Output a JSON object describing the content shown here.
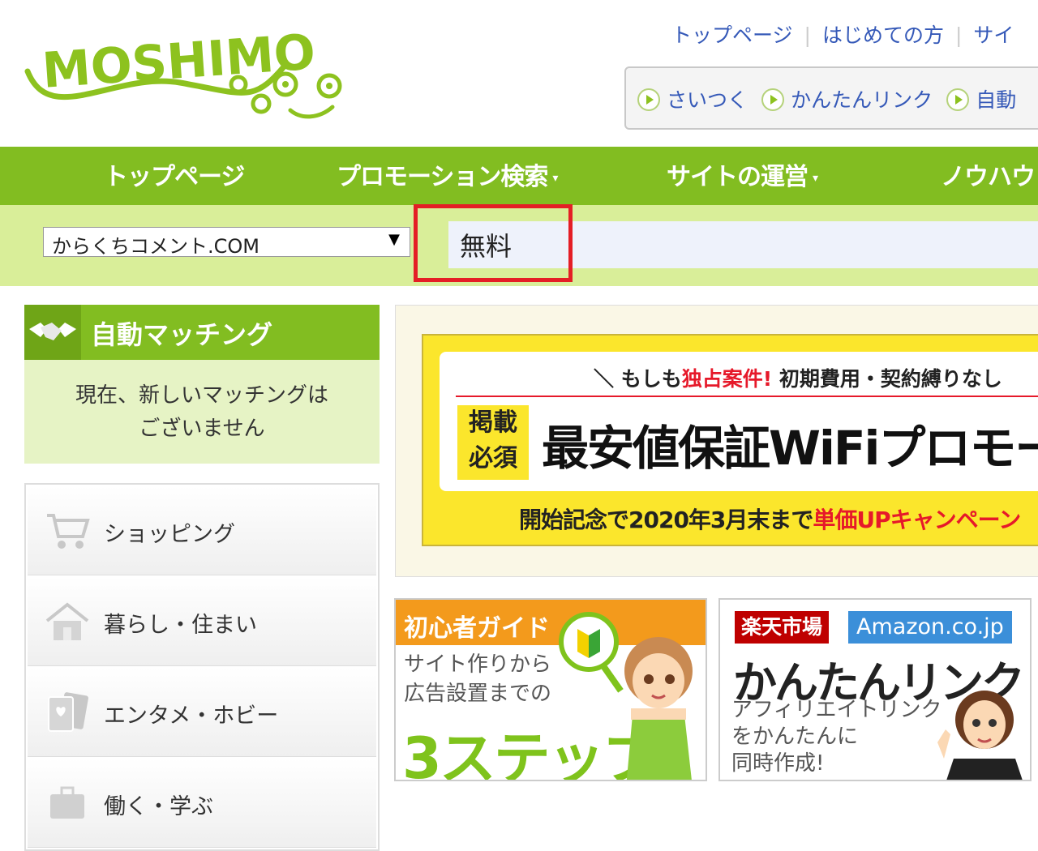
{
  "header": {
    "logo_text": "MOSHIMO",
    "top_links": [
      "トップページ",
      "はじめての方",
      "サイ"
    ],
    "quick_links": [
      "さいつく",
      "かんたんリンク",
      "自動"
    ]
  },
  "nav": {
    "items": [
      {
        "label": "トップページ",
        "has_dropdown": false
      },
      {
        "label": "プロモーション検索",
        "has_dropdown": true
      },
      {
        "label": "サイトの運営",
        "has_dropdown": true
      },
      {
        "label": "ノウハウ",
        "has_dropdown": false
      }
    ],
    "caret": "▾"
  },
  "search": {
    "site_select_value": "からくちコメント.COM",
    "select_arrow": "▼",
    "keyword_value": "無料"
  },
  "auto_matching": {
    "title": "自動マッチング",
    "message_line1": "現在、新しいマッチングは",
    "message_line2": "ございません"
  },
  "categories": [
    {
      "label": "ショッピング",
      "icon": "cart-icon"
    },
    {
      "label": "暮らし・住まい",
      "icon": "house-icon"
    },
    {
      "label": "エンタメ・ホビー",
      "icon": "cards-icon"
    },
    {
      "label": "働く・学ぶ",
      "icon": "work-icon"
    }
  ],
  "promo_banner": {
    "top_prefix": "＼ もしも",
    "top_exclusive": "独占案件!",
    "top_suffix": " 初期費用・契約縛りなし",
    "badge_line1": "掲載",
    "badge_line2": "必須",
    "headline": "最安値保証WiFiプロモーション",
    "bottom_text": "開始記念で2020年3月末まで",
    "bottom_highlight": "単価UPキャンペーン"
  },
  "guide_banner": {
    "title": "初心者ガイド",
    "sub_line1": "サイト作りから",
    "sub_line2": "広告設置までの",
    "big_text": "3ステップ"
  },
  "link_banner": {
    "tag_rakuten": "楽天市場",
    "tag_amazon": "Amazon.co.jp",
    "title": "かんたんリンク",
    "desc_line1": "アフィリエイトリンク",
    "desc_line2": "をかんたんに",
    "desc_line3": "同時作成!"
  },
  "colors": {
    "brand_green": "#82bd21",
    "search_band": "#d9ee99",
    "highlight_red": "#e41e25",
    "link_blue": "#3559b8",
    "banner_yellow": "#fbe62c",
    "guide_orange": "#f39a1c"
  }
}
